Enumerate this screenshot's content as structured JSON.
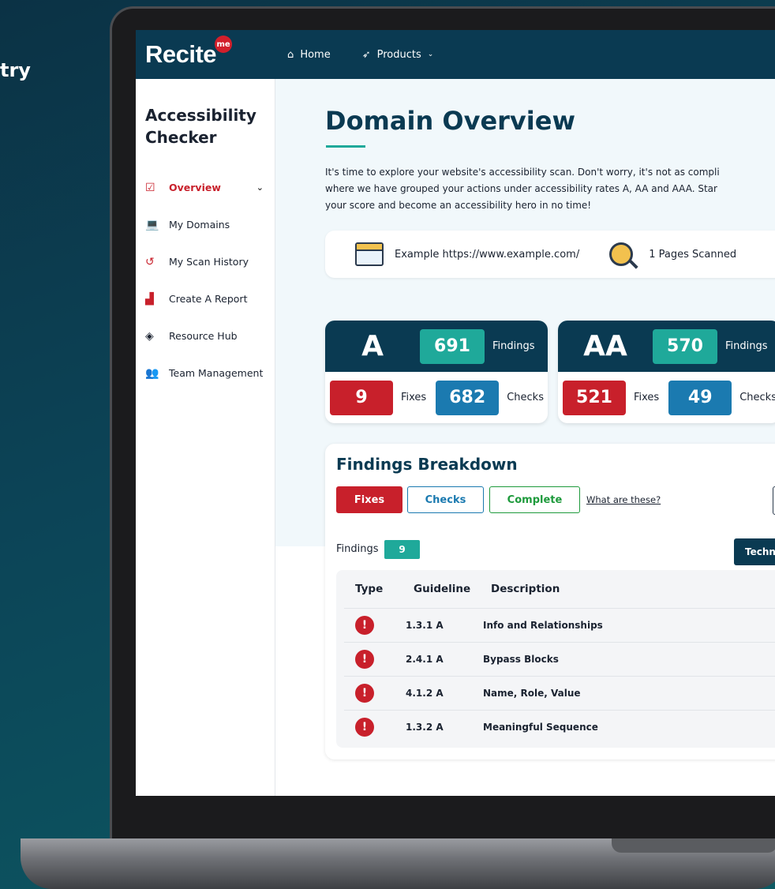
{
  "backdrop": {
    "side_text": "try"
  },
  "header": {
    "logo_text": "Recite",
    "logo_badge": "me",
    "nav": [
      {
        "label": "Home",
        "icon": "home-icon"
      },
      {
        "label": "Products",
        "icon": "rocket-icon"
      }
    ]
  },
  "sidebar": {
    "title_line1": "Accessibility",
    "title_line2": "Checker",
    "items": [
      {
        "label": "Overview",
        "icon": "checkbox-icon",
        "active": true
      },
      {
        "label": "My Domains",
        "icon": "laptop-icon"
      },
      {
        "label": "My Scan History",
        "icon": "history-icon"
      },
      {
        "label": "Create A Report",
        "icon": "bar-chart-icon"
      },
      {
        "label": "Resource Hub",
        "icon": "graduation-cap-icon"
      },
      {
        "label": "Team Management",
        "icon": "team-icon"
      }
    ]
  },
  "main": {
    "title": "Domain Overview",
    "intro": [
      "It's time to explore your website's accessibility scan. Don't worry, it's not as compli",
      "where we have grouped your actions under accessibility rates A, AA and AAA. Star",
      "your score and become an accessibility hero in no time!"
    ],
    "domain_label": "Example https://www.example.com/",
    "pages_scanned": "1 Pages Scanned"
  },
  "scores": [
    {
      "level": "A",
      "findings": "691",
      "findings_label": "Findings",
      "fixes": "9",
      "fixes_label": "Fixes",
      "checks": "682",
      "checks_label": "Checks"
    },
    {
      "level": "AA",
      "findings": "570",
      "findings_label": "Findings",
      "fixes": "521",
      "fixes_label": "Fixes",
      "checks": "49",
      "checks_label": "Checks"
    }
  ],
  "findings": {
    "title": "Findings Breakdown",
    "tabs": [
      "Fixes",
      "Checks",
      "Complete"
    ],
    "help_link": "What are these?",
    "count_label": "Findings",
    "count": "9",
    "tech_button": "Techn",
    "columns": [
      "Type",
      "Guideline",
      "Description"
    ],
    "rows": [
      {
        "type": "!",
        "guideline": "1.3.1 A",
        "description": "Info and Relationships"
      },
      {
        "type": "!",
        "guideline": "2.4.1 A",
        "description": "Bypass Blocks"
      },
      {
        "type": "!",
        "guideline": "4.1.2 A",
        "description": "Name, Role, Value"
      },
      {
        "type": "!",
        "guideline": "1.3.2 A",
        "description": "Meaningful Sequence"
      }
    ]
  },
  "colors": {
    "navy": "#0a3a52",
    "teal": "#1fa99a",
    "red": "#c8202b",
    "blue": "#1b7ab0",
    "green": "#1e9a3c"
  }
}
